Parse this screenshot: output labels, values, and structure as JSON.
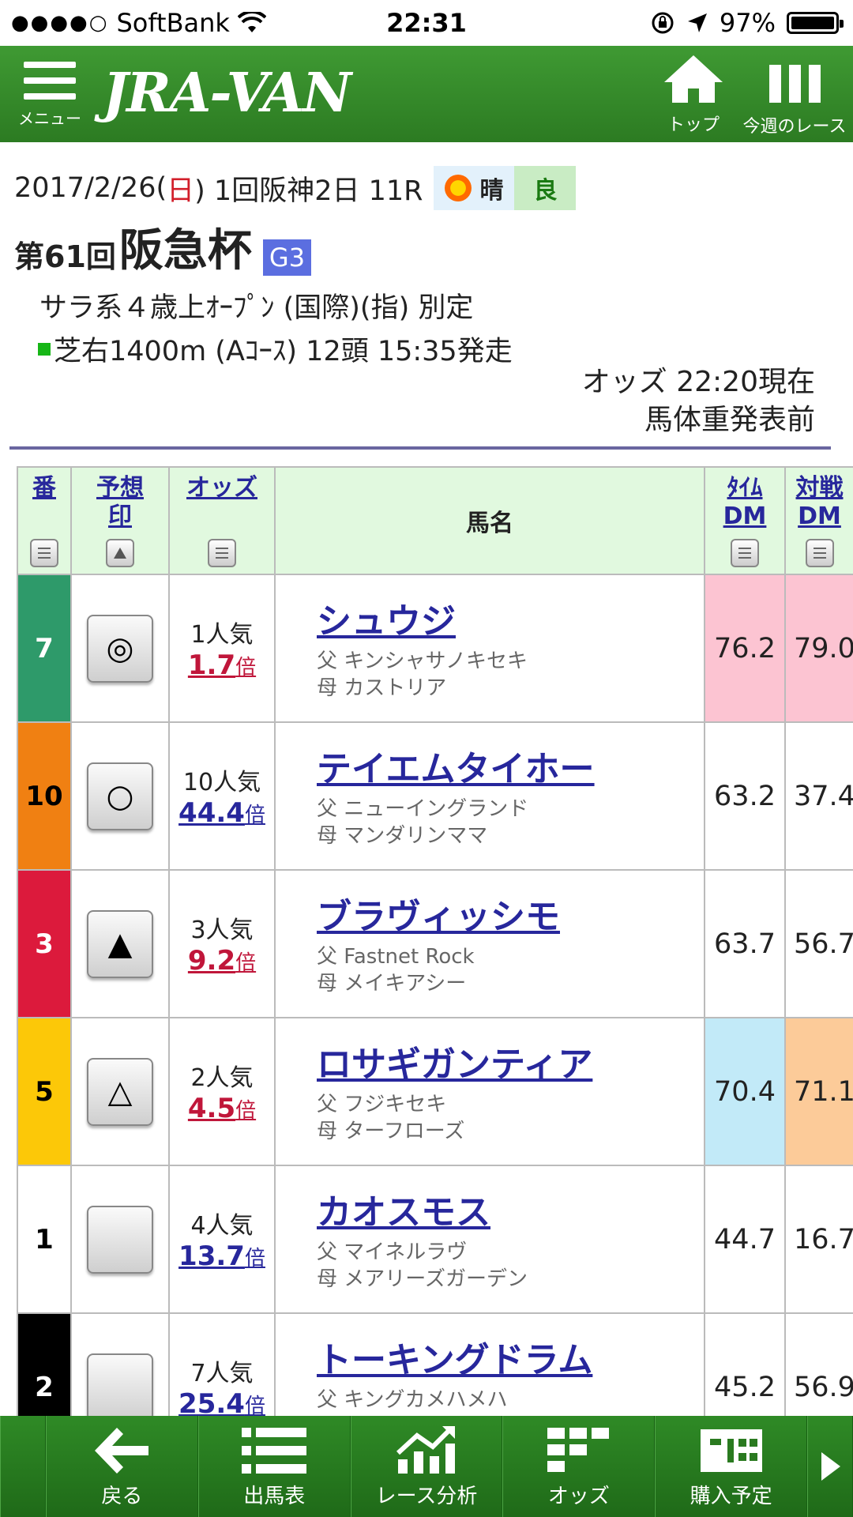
{
  "status": {
    "signal": "●●●●○",
    "carrier": "SoftBank",
    "time": "22:31",
    "battery": "97%"
  },
  "header": {
    "menu_label": "メニュー",
    "logo": "JRA-VAN",
    "top_label": "トップ",
    "week_label": "今週のレース"
  },
  "race": {
    "date_prefix": "2017/2/26(",
    "date_day": "日",
    "date_suffix": ") 1回阪神2日 11R",
    "weather": "晴",
    "track_condition": "良",
    "edition": "第61回",
    "name": "阪急杯",
    "grade": "G3",
    "conditions": "サラ系４歳上ｵｰﾌﾟﾝ (国際)(指) 別定",
    "course": "芝右1400m (Aｺｰｽ) 12頭 15:35発走",
    "odds_time": "オッズ 22:20現在",
    "weight_status": "馬体重発表前"
  },
  "table": {
    "headers": {
      "num": "番",
      "mark_line1": "予想",
      "mark_line2": "印",
      "odds": "オッズ",
      "name": "馬名",
      "time_dm_line1": "ﾀｲﾑ",
      "time_dm_line2": "DM",
      "vs_dm_line1": "対戦",
      "vs_dm_line2": "DM"
    },
    "rows": [
      {
        "num": "7",
        "num_bg": "#2e9a6a",
        "num_color": "#ffffff",
        "mark": "◎",
        "popularity": "1人気",
        "odds": "1.7",
        "odds_color": "red",
        "bai": "倍",
        "name": "シュウジ",
        "sire": "父 キンシャサノキセキ",
        "dam": "母 カストリア",
        "time_dm": "76.2",
        "time_dm_bg": "#fcc4d2",
        "vs_dm": "79.0",
        "vs_dm_bg": "#fcc4d2"
      },
      {
        "num": "10",
        "num_bg": "#f08012",
        "num_color": "#000000",
        "mark": "○",
        "popularity": "10人気",
        "odds": "44.4",
        "odds_color": "blue",
        "bai": "倍",
        "name": "テイエムタイホー",
        "sire": "父 ニューイングランド",
        "dam": "母 マンダリンママ",
        "time_dm": "63.2",
        "time_dm_bg": "#ffffff",
        "vs_dm": "37.4",
        "vs_dm_bg": "#ffffff"
      },
      {
        "num": "3",
        "num_bg": "#dc1a3c",
        "num_color": "#ffffff",
        "mark": "▲",
        "popularity": "3人気",
        "odds": "9.2",
        "odds_color": "red",
        "bai": "倍",
        "name": "ブラヴィッシモ",
        "sire": "父 Fastnet Rock",
        "dam": "母 メイキアシー",
        "time_dm": "63.7",
        "time_dm_bg": "#ffffff",
        "vs_dm": "56.7",
        "vs_dm_bg": "#ffffff"
      },
      {
        "num": "5",
        "num_bg": "#fcc808",
        "num_color": "#000000",
        "mark": "△",
        "popularity": "2人気",
        "odds": "4.5",
        "odds_color": "red",
        "bai": "倍",
        "name": "ロサギガンティア",
        "sire": "父 フジキセキ",
        "dam": "母 ターフローズ",
        "time_dm": "70.4",
        "time_dm_bg": "#c2eaf8",
        "vs_dm": "71.1",
        "vs_dm_bg": "#fccb99"
      },
      {
        "num": "1",
        "num_bg": "#ffffff",
        "num_color": "#000000",
        "mark": "",
        "popularity": "4人気",
        "odds": "13.7",
        "odds_color": "blue",
        "bai": "倍",
        "name": "カオスモス",
        "sire": "父 マイネルラヴ",
        "dam": "母 メアリーズガーデン",
        "time_dm": "44.7",
        "time_dm_bg": "#ffffff",
        "vs_dm": "16.7",
        "vs_dm_bg": "#ffffff"
      },
      {
        "num": "2",
        "num_bg": "#000000",
        "num_color": "#ffffff",
        "mark": "",
        "popularity": "7人気",
        "odds": "25.4",
        "odds_color": "blue",
        "bai": "倍",
        "name": "トーキングドラム",
        "sire": "父 キングカメハメハ",
        "dam": "",
        "time_dm": "45.2",
        "time_dm_bg": "#ffffff",
        "vs_dm": "56.9",
        "vs_dm_bg": "#ffffff"
      }
    ]
  },
  "toolbar": {
    "back": "戻る",
    "entries": "出馬表",
    "analysis": "レース分析",
    "odds": "オッズ",
    "purchase": "購入予定"
  }
}
